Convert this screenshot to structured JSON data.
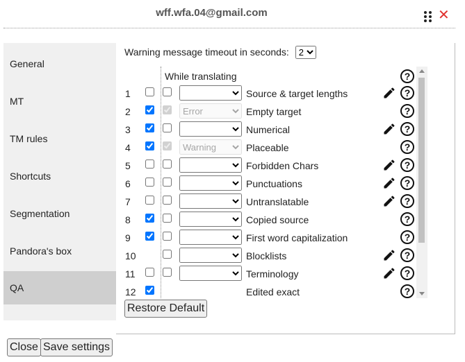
{
  "header": {
    "title": "wff.wfa.04@gmail.com",
    "menu_icon": "drag-dots-icon",
    "close_icon": "close-icon"
  },
  "sidebar": {
    "items": [
      {
        "label": "General"
      },
      {
        "label": "MT"
      },
      {
        "label": "TM rules"
      },
      {
        "label": "Shortcuts"
      },
      {
        "label": "Segmentation"
      },
      {
        "label": "Pandora's box"
      },
      {
        "label": "QA",
        "active": true
      }
    ]
  },
  "qa": {
    "timeout_label": "Warning message timeout in seconds:",
    "timeout_value": "2",
    "timeout_options": [
      "2"
    ],
    "while_translating_label": "While translating",
    "rows": [
      {
        "num": "1",
        "enabled": false,
        "translating": false,
        "severity": "",
        "disabled": false,
        "name": "Source & target lengths",
        "editable": true
      },
      {
        "num": "2",
        "enabled": true,
        "translating": true,
        "severity": "Error",
        "disabled": true,
        "name": "Empty target",
        "editable": false
      },
      {
        "num": "3",
        "enabled": true,
        "translating": false,
        "severity": "",
        "disabled": false,
        "name": "Numerical",
        "editable": true
      },
      {
        "num": "4",
        "enabled": true,
        "translating": true,
        "severity": "Warning",
        "disabled": true,
        "name": "Placeable",
        "editable": false
      },
      {
        "num": "5",
        "enabled": false,
        "translating": false,
        "severity": "",
        "disabled": false,
        "name": "Forbidden Chars",
        "editable": true
      },
      {
        "num": "6",
        "enabled": false,
        "translating": false,
        "severity": "",
        "disabled": false,
        "name": "Punctuations",
        "editable": true
      },
      {
        "num": "7",
        "enabled": false,
        "translating": false,
        "severity": "",
        "disabled": false,
        "name": "Untranslatable",
        "editable": true
      },
      {
        "num": "8",
        "enabled": true,
        "translating": false,
        "severity": "",
        "disabled": false,
        "name": "Copied source",
        "editable": false
      },
      {
        "num": "9",
        "enabled": true,
        "translating": false,
        "severity": "",
        "disabled": false,
        "name": "First word capitalization",
        "editable": false
      },
      {
        "num": "10",
        "enabled": null,
        "translating": false,
        "severity": "",
        "disabled": false,
        "name": "Blocklists",
        "editable": true
      },
      {
        "num": "11",
        "enabled": false,
        "translating": false,
        "severity": "",
        "disabled": false,
        "name": "Terminology",
        "editable": true
      },
      {
        "num": "12",
        "enabled": true,
        "translating": null,
        "severity": null,
        "disabled": false,
        "name": "Edited exact",
        "editable": false
      }
    ],
    "restore_label": "Restore Default"
  },
  "footer": {
    "close_label": "Close",
    "save_label": "Save settings"
  },
  "colors": {
    "close_icon": "#e0322f",
    "checkbox_accent": "#0075ff",
    "sidebar_bg": "#f0f0f0",
    "sidebar_active_bg": "#cfcfcf"
  }
}
